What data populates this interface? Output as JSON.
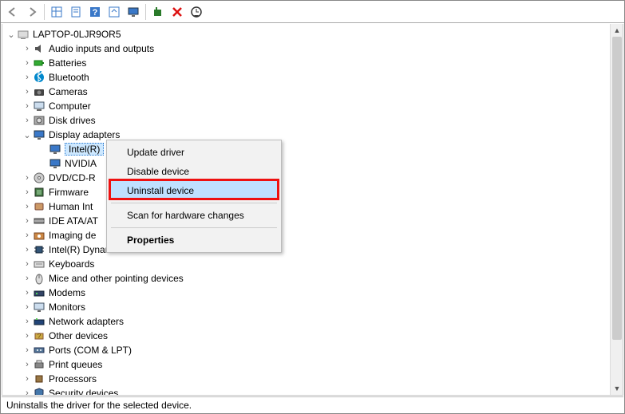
{
  "toolbar_icons": [
    "back-icon",
    "forward-icon",
    "sep",
    "show-hidden-icon",
    "properties-icon",
    "help-icon",
    "update-icon",
    "monitor-icon",
    "sep",
    "add-legacy-icon",
    "remove-icon",
    "scan-icon"
  ],
  "root": {
    "label": "LAPTOP-0LJR9OR5",
    "expanded": true
  },
  "categories": [
    {
      "label": "Audio inputs and outputs",
      "icon": "speaker",
      "expanded": false
    },
    {
      "label": "Batteries",
      "icon": "battery",
      "expanded": false
    },
    {
      "label": "Bluetooth",
      "icon": "bluetooth",
      "expanded": false
    },
    {
      "label": "Cameras",
      "icon": "camera",
      "expanded": false
    },
    {
      "label": "Computer",
      "icon": "computer",
      "expanded": false
    },
    {
      "label": "Disk drives",
      "icon": "disk",
      "expanded": false
    },
    {
      "label": "Display adapters",
      "icon": "display",
      "expanded": true,
      "children": [
        {
          "label": "Intel(R)",
          "icon": "display",
          "selected": true
        },
        {
          "label": "NVIDIA",
          "icon": "display"
        }
      ]
    },
    {
      "label": "DVD/CD-R",
      "icon": "dvd",
      "expanded": false,
      "truncated": true
    },
    {
      "label": "Firmware",
      "icon": "firmware",
      "expanded": false,
      "truncated": true
    },
    {
      "label": "Human Int",
      "icon": "hid",
      "expanded": false,
      "truncated": true
    },
    {
      "label": "IDE ATA/AT",
      "icon": "ide",
      "expanded": false,
      "truncated": true
    },
    {
      "label": "Imaging de",
      "icon": "imaging",
      "expanded": false,
      "truncated": true
    },
    {
      "label": "Intel(R) Dynamic Platform and Thermal Framework",
      "icon": "chip",
      "expanded": false
    },
    {
      "label": "Keyboards",
      "icon": "keyboard",
      "expanded": false
    },
    {
      "label": "Mice and other pointing devices",
      "icon": "mouse",
      "expanded": false
    },
    {
      "label": "Modems",
      "icon": "modem",
      "expanded": false
    },
    {
      "label": "Monitors",
      "icon": "monitor",
      "expanded": false
    },
    {
      "label": "Network adapters",
      "icon": "network",
      "expanded": false
    },
    {
      "label": "Other devices",
      "icon": "other",
      "expanded": false
    },
    {
      "label": "Ports (COM & LPT)",
      "icon": "port",
      "expanded": false
    },
    {
      "label": "Print queues",
      "icon": "printer",
      "expanded": false
    },
    {
      "label": "Processors",
      "icon": "cpu",
      "expanded": false
    },
    {
      "label": "Security devices",
      "icon": "security",
      "expanded": false,
      "cut": true
    }
  ],
  "context_menu": {
    "items": [
      {
        "label": "Update driver"
      },
      {
        "label": "Disable device"
      },
      {
        "label": "Uninstall device",
        "hover": true,
        "highlight": true
      },
      {
        "sep": true
      },
      {
        "label": "Scan for hardware changes"
      },
      {
        "sep": true
      },
      {
        "label": "Properties",
        "bold": true
      }
    ]
  },
  "statusbar": "Uninstalls the driver for the selected device.",
  "chevrons": {
    "expanded": "⌄",
    "collapsed": "›"
  }
}
